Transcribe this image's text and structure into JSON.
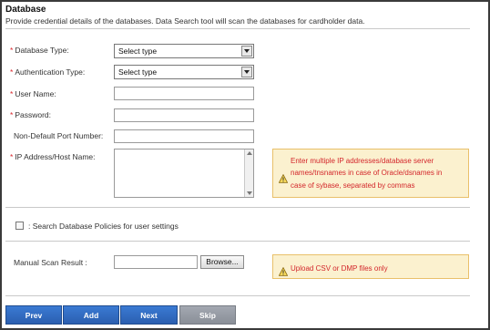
{
  "header": {
    "title": "Database",
    "description": "Provide credential details of the databases. Data Search tool will scan the databases for cardholder data."
  },
  "form": {
    "database_type": {
      "label": "Database Type:",
      "required": "*",
      "value": "Select type"
    },
    "authentication_type": {
      "label": "Authentication Type:",
      "required": "*",
      "value": "Select type"
    },
    "user_name": {
      "label": "User Name:",
      "required": "*",
      "value": ""
    },
    "password": {
      "label": "Password:",
      "required": "*",
      "value": ""
    },
    "port": {
      "label": "Non-Default Port Number:",
      "value": ""
    },
    "ip_address": {
      "label": "IP Address/Host Name:",
      "required": "*",
      "value": "",
      "hint_lines": [
        "Enter multiple IP addresses/database server",
        "names/tnsnames in case of Oracle/dsnames in",
        "case of sybase, separated by commas"
      ]
    },
    "policies_checkbox": {
      "label": ": Search Database Policies for user settings",
      "checked": false
    },
    "manual_scan": {
      "label": "Manual Scan Result :",
      "value": "",
      "browse_label": "Browse...",
      "hint": "Upload CSV or DMP files only"
    }
  },
  "buttons": {
    "prev": "Prev",
    "add": "Add",
    "next": "Next",
    "skip": "Skip"
  },
  "colors": {
    "required": "#d9262c",
    "warning_bg": "#fbf1cf",
    "warning_text": "#d3262b",
    "button_blue": "#2f6bc4",
    "button_grey": "#9196a0"
  },
  "icons": {
    "warning": "warning-triangle-icon",
    "dropdown": "chevron-down-icon"
  }
}
